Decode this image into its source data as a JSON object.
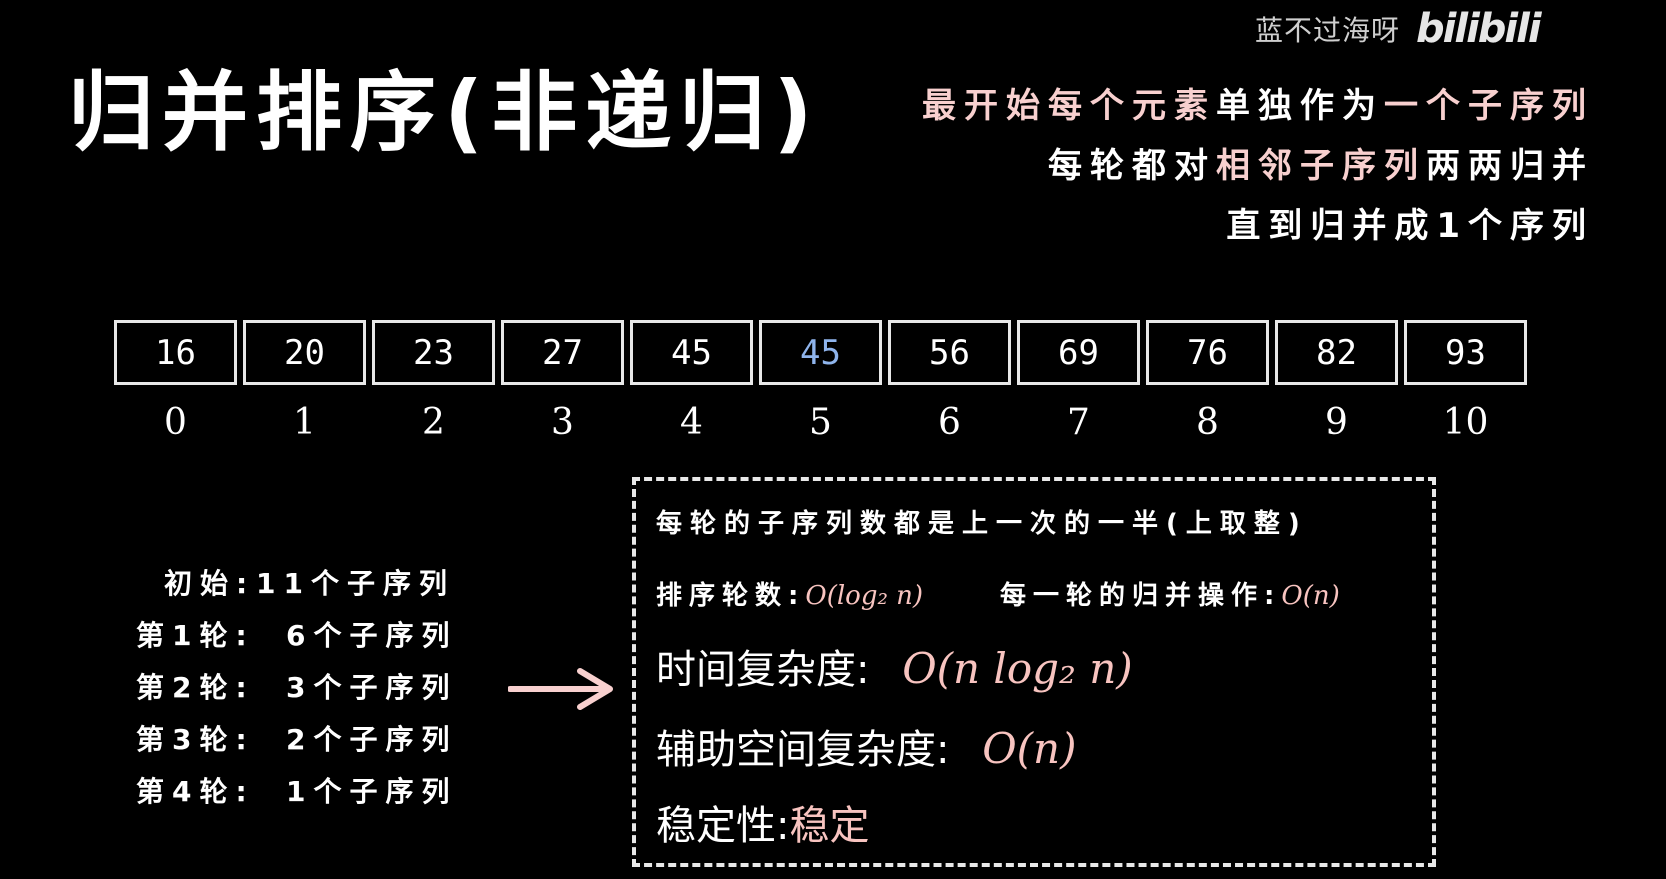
{
  "watermark": {
    "author": "蓝不过海呀",
    "logo": "bilibili"
  },
  "title": "归并排序(非递归)",
  "description": [
    {
      "pink": "最开始每个元素",
      "white": "单独作为",
      "pink2": "一个子序列"
    },
    {
      "white": "每轮都对",
      "pink": "相邻子序列",
      "white2": "两两归并"
    },
    {
      "white": "直到归并成1个序列"
    }
  ],
  "array": {
    "values": [
      "16",
      "20",
      "23",
      "27",
      "45",
      "45",
      "56",
      "69",
      "76",
      "82",
      "93"
    ],
    "highlight_index": 5,
    "highlight_color": "#8fb4ec",
    "indices": [
      "0",
      "1",
      "2",
      "3",
      "4",
      "5",
      "6",
      "7",
      "8",
      "9",
      "10"
    ]
  },
  "rounds": [
    {
      "label": "初始:",
      "value": "11个子序列"
    },
    {
      "label": "第1轮:",
      "value": "6个子序列"
    },
    {
      "label": "第2轮:",
      "value": "3个子序列"
    },
    {
      "label": "第3轮:",
      "value": "2个子序列"
    },
    {
      "label": "第4轮:",
      "value": "1个子序列"
    }
  ],
  "analysis": {
    "heading": "每轮的子序列数都是上一次的一半(上取整)",
    "rounds_label": "排序轮数:",
    "rounds_value": "O(log₂ n)",
    "per_round_label": "每一轮的归并操作:",
    "per_round_value": "O(n)",
    "time_label": "时间复杂度:",
    "time_value": "O(n log₂ n)",
    "space_label": "辅助空间复杂度:",
    "space_value": "O(n)",
    "stability_label": "稳定性:",
    "stability_value": "稳定"
  },
  "colors": {
    "accent": "#f8c4c0",
    "pink_text": "#f8d0cf",
    "highlight": "#8fb4ec",
    "background": "#000000"
  }
}
